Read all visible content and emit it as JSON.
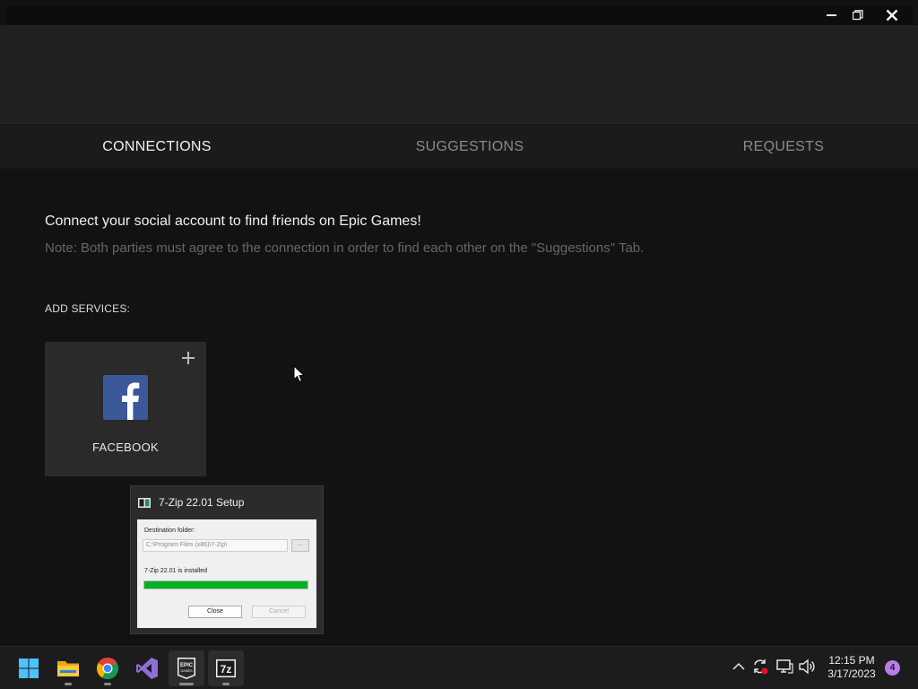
{
  "window": {
    "controls": {
      "minimize": "minimize",
      "restore": "restore",
      "close": "close"
    }
  },
  "tabs": [
    {
      "label": "CONNECTIONS",
      "active": true
    },
    {
      "label": "SUGGESTIONS",
      "active": false
    },
    {
      "label": "REQUESTS",
      "active": false
    }
  ],
  "content": {
    "headline": "Connect your social account to find friends on Epic Games!",
    "note": "Note: Both parties must agree to the connection in order to find each other on the \"Suggestions\" Tab.",
    "add_services_label": "ADD SERVICES:",
    "services": [
      {
        "name": "FACEBOOK",
        "icon": "facebook-icon",
        "brand_color": "#3b5998"
      }
    ]
  },
  "preview": {
    "title": "7-Zip 22.01 Setup",
    "destination_label": "Destination folder:",
    "destination_path": "C:\\Program Files (x86)\\7-Zip\\",
    "browse_label": "...",
    "status": "7-Zip 22.01 is installed",
    "progress": 1.0,
    "progress_color": "#06b025",
    "close_label": "Close",
    "cancel_label": "Cancel"
  },
  "taskbar": {
    "apps": [
      {
        "name": "start",
        "icon": "windows-start-icon"
      },
      {
        "name": "file-explorer",
        "icon": "folder-icon"
      },
      {
        "name": "chrome",
        "icon": "chrome-icon"
      },
      {
        "name": "visual-studio",
        "icon": "visual-studio-icon"
      },
      {
        "name": "epic-games",
        "icon": "epic-games-icon",
        "label": "EPIC GAMES"
      },
      {
        "name": "7-zip",
        "icon": "7zip-icon",
        "label": "7z"
      }
    ],
    "clock_time": "12:15 PM",
    "clock_date": "3/17/2023",
    "notification_count": "4"
  }
}
